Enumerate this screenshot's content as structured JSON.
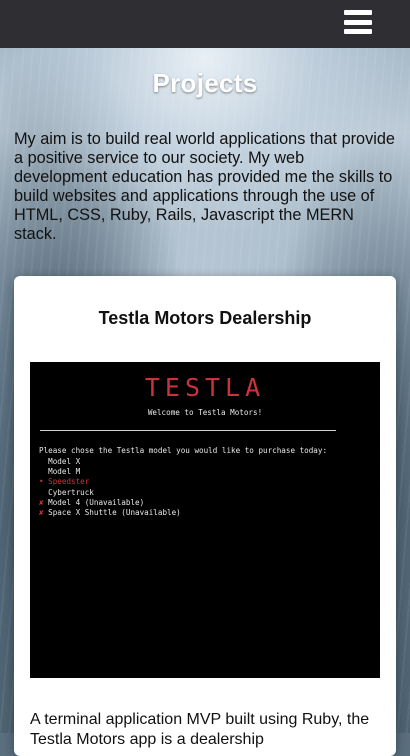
{
  "header": {
    "menu_icon": "hamburger-menu-icon"
  },
  "page": {
    "title": "Projects",
    "intro": "My aim is to build real world applications that provide a positive service to our society. My web development education has provided me the skills to build websites and applications through the use of HTML, CSS, Ruby, Rails, Javascript the MERN stack."
  },
  "project": {
    "title": "Testla Motors Dealership",
    "screenshot": {
      "logo": "TESTLA",
      "welcome": "Welcome to Testla Motors!",
      "prompt": "Please chose the Testla model you would like to purchase today:",
      "options": [
        {
          "marker": " ",
          "label": "Model X"
        },
        {
          "marker": " ",
          "label": "Model M"
        },
        {
          "marker": "•",
          "label": "Speedster"
        },
        {
          "marker": " ",
          "label": "Cybertruck"
        },
        {
          "marker": "✘",
          "label": "Model 4 (Unavailable)"
        },
        {
          "marker": "✘",
          "label": "Space X Shuttle (Unavailable)"
        }
      ],
      "selected_color": "#d0333a"
    },
    "description": "A terminal application MVP built using Ruby, the Testla Motors app is a dealership"
  }
}
